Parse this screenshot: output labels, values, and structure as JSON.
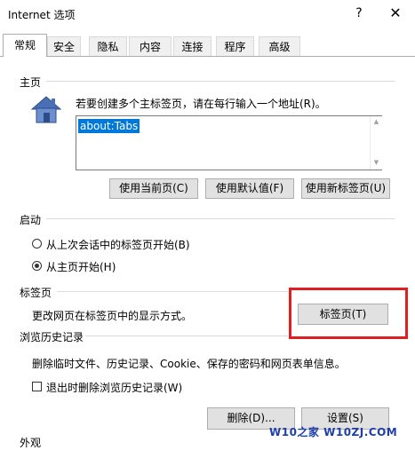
{
  "window": {
    "title": "Internet 选项",
    "help_glyph": "?",
    "close_glyph": "✕"
  },
  "tabs": [
    "常规",
    "安全",
    "隐私",
    "内容",
    "连接",
    "程序",
    "高级"
  ],
  "home": {
    "section_label": "主页",
    "description": "若要创建多个主标签页，请在每行输入一个地址(R)。",
    "url_value": "about:Tabs",
    "buttons": {
      "use_current": "使用当前页(C)",
      "use_default": "使用默认值(F)",
      "use_new_tab": "使用新标签页(U)"
    }
  },
  "startup": {
    "section_label": "启动",
    "option_last_session": "从上次会话中的标签页开始(B)",
    "option_home_page": "从主页开始(H)",
    "selected": "home_page"
  },
  "tabs_section": {
    "section_label": "标签页",
    "description": "更改网页在标签页中的显示方式。",
    "button": "标签页(T)"
  },
  "history": {
    "section_label": "浏览历史记录",
    "description": "删除临时文件、历史记录、Cookie、保存的密码和网页表单信息。",
    "checkbox_label": "退出时删除浏览历史记录(W)",
    "checkbox_checked": false,
    "delete_button": "删除(D)...",
    "settings_button": "设置(S)"
  },
  "appearance": {
    "section_label": "外观"
  },
  "watermark": "W10之家 W10ZJ.COM",
  "colors": {
    "highlight": "#e02020",
    "selection": "#0078d7",
    "watermark": "#1d3fa8"
  }
}
